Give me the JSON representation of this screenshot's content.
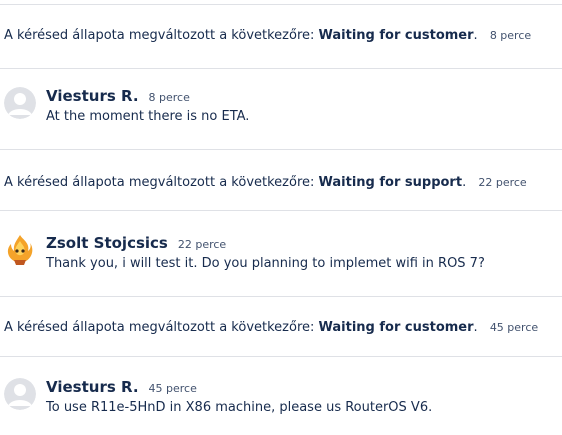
{
  "status_prefix": "A kérésed állapota megváltozott a következőre: ",
  "events": [
    {
      "type": "status",
      "status": "Waiting for customer",
      "time": "8 perce"
    },
    {
      "type": "comment",
      "author": "Viesturs R.",
      "time": "8 perce",
      "text": "At the moment there is no ETA.",
      "avatar": "default-user-avatar"
    },
    {
      "type": "status",
      "status": "Waiting for support",
      "time": "22 perce"
    },
    {
      "type": "comment",
      "author": "Zsolt Stojcsics",
      "time": "22 perce",
      "text": "Thank you, i will test it. Do you planning to implemet wifi in ROS 7?",
      "avatar": "flame-character-avatar"
    },
    {
      "type": "status",
      "status": "Waiting for customer",
      "time": "45 perce"
    },
    {
      "type": "comment",
      "author": "Viesturs R.",
      "time": "45 perce",
      "text": "To use R11e-5HnD in X86 machine, please us RouterOS V6.",
      "avatar": "default-user-avatar"
    }
  ],
  "colors": {
    "text": "#172b4d",
    "meta": "#42526e",
    "divider": "#dfe1e6",
    "avatar_bg": "#dfe1e6"
  }
}
